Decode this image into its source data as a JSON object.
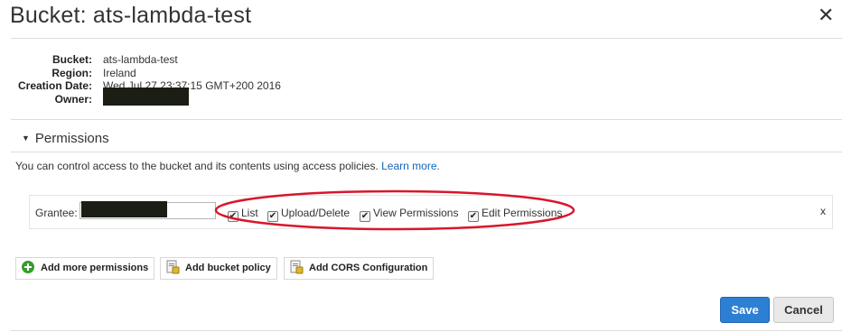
{
  "header": {
    "title": "Bucket: ats-lambda-test",
    "close_glyph": "✕"
  },
  "properties": [
    {
      "label": "Bucket:",
      "value": "ats-lambda-test"
    },
    {
      "label": "Region:",
      "value": "Ireland"
    },
    {
      "label": "Creation Date:",
      "value": "Wed Jul 27 23:37:15 GMT+200 2016"
    },
    {
      "label": "Owner:",
      "value": ""
    }
  ],
  "permissions": {
    "section_title": "Permissions",
    "description": "You can control access to the bucket and its contents using access policies. ",
    "learn_more": "Learn more.",
    "grantee_label": "Grantee:",
    "checkboxes": [
      {
        "label": "List",
        "checked": true
      },
      {
        "label": "Upload/Delete",
        "checked": true
      },
      {
        "label": "View Permissions",
        "checked": true
      },
      {
        "label": "Edit Permissions",
        "checked": true
      }
    ],
    "remove_label": "x",
    "highlight_color": "#d8172b"
  },
  "actions": {
    "add_more_permissions": "Add more permissions",
    "add_bucket_policy": "Add bucket policy",
    "add_cors": "Add CORS Configuration"
  },
  "footer": {
    "save": "Save",
    "cancel": "Cancel"
  },
  "colors": {
    "primary": "#2d7fd3",
    "link": "#1166bb"
  }
}
